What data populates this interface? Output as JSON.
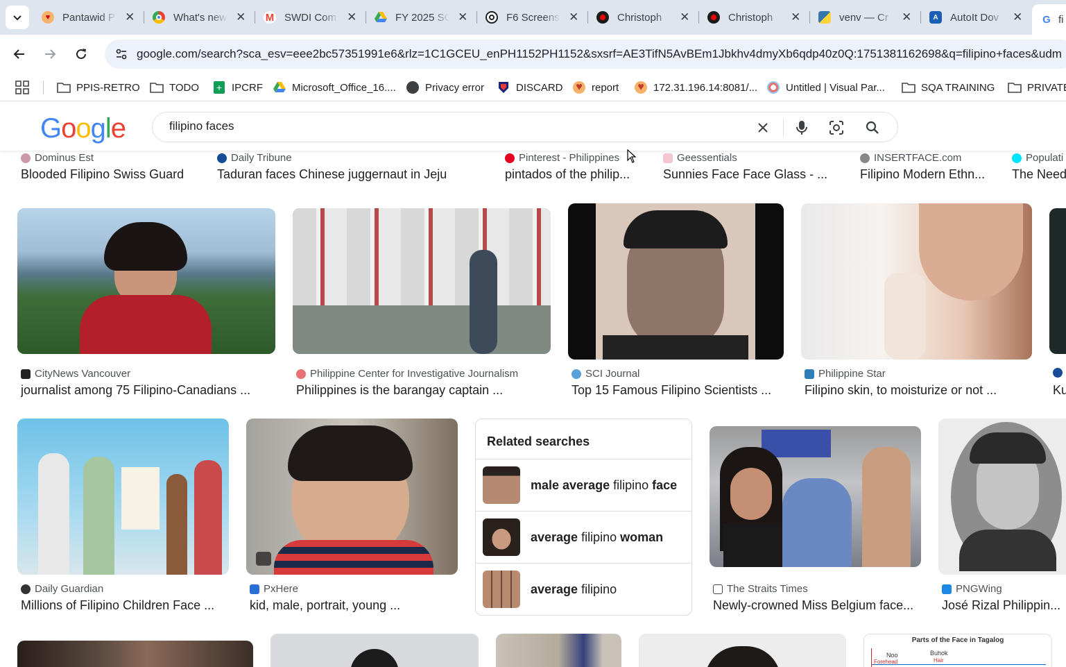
{
  "tabs": [
    {
      "title": "Pantawid P",
      "favicon": "heart-icon",
      "color": "#e8453c"
    },
    {
      "title": "What's new",
      "favicon": "chrome-icon",
      "color": "#4285f4"
    },
    {
      "title": "SWDI Com",
      "favicon": "gmail-icon",
      "color": "#ea4335"
    },
    {
      "title": "FY 2025 SC",
      "favicon": "drive-icon",
      "color": "#fbbc04"
    },
    {
      "title": "F6 Screens",
      "favicon": "openai-icon",
      "color": "#202124"
    },
    {
      "title": "Christoph",
      "favicon": "red-circle-icon",
      "color": "#b00020"
    },
    {
      "title": "Christoph",
      "favicon": "red-circle-icon",
      "color": "#b00020"
    },
    {
      "title": "venv — Cr",
      "favicon": "python-icon",
      "color": "#3776ab"
    },
    {
      "title": "AutoIt Dov",
      "favicon": "autoit-icon",
      "color": "#1a5fb4"
    },
    {
      "title": "fi",
      "favicon": "google-icon",
      "color": "#4285f4"
    }
  ],
  "omnibox": {
    "url": "google.com/search?sca_esv=eee2bc57351991e6&rlz=1C1GCEU_enPH1152PH1152&sxsrf=AE3TifN5AvBEm1Jbkhv4dmyXb6qdp40z0Q:1751381162698&q=filipino+faces&udm"
  },
  "bookmarks": [
    {
      "label": "PPIS-RETRO",
      "icon": "folder-icon"
    },
    {
      "label": "TODO",
      "icon": "folder-icon"
    },
    {
      "label": "IPCRF",
      "icon": "sheets-icon"
    },
    {
      "label": "Microsoft_Office_16....",
      "icon": "drive-icon"
    },
    {
      "label": "Privacy error",
      "icon": "globe-icon"
    },
    {
      "label": "DISCARD",
      "icon": "shield-icon"
    },
    {
      "label": "report",
      "icon": "heart-icon"
    },
    {
      "label": "172.31.196.14:8081/...",
      "icon": "heart-icon"
    },
    {
      "label": "Untitled | Visual Par...",
      "icon": "vp-icon"
    },
    {
      "label": "SQA TRAINING",
      "icon": "folder-icon"
    },
    {
      "label": "PRIVATE",
      "icon": "folder-icon"
    }
  ],
  "search": {
    "logo": "Google",
    "query": "filipino faces"
  },
  "top_row": [
    {
      "source": "Dominus Est",
      "caption": "Blooded Filipino Swiss Guard"
    },
    {
      "source": "Daily Tribune",
      "caption": "Taduran faces Chinese juggernaut in Jeju"
    },
    {
      "source": "Pinterest - Philippines",
      "caption": "pintados of the philip..."
    },
    {
      "source": "Geessentials",
      "caption": "Sunnies Face Face Glass - ..."
    },
    {
      "source": "INSERTFACE.com",
      "caption": "Filipino Modern Ethn..."
    },
    {
      "source": "Populati",
      "caption": "The Need"
    }
  ],
  "row2": [
    {
      "source": "CityNews Vancouver",
      "caption": "journalist among 75 Filipino-Canadians ..."
    },
    {
      "source": "Philippine Center for Investigative Journalism",
      "caption": "Philippines is the barangay captain ..."
    },
    {
      "source": "SCI Journal",
      "caption": "Top 15 Famous Filipino Scientists ..."
    },
    {
      "source": "Philippine Star",
      "caption": "Filipino skin, to moisturize or not ..."
    },
    {
      "source": "",
      "caption": "Ku"
    }
  ],
  "row3": [
    {
      "source": "Daily Guardian",
      "caption": "Millions of Filipino Children Face ..."
    },
    {
      "source": "PxHere",
      "caption": "kid, male, portrait, young ..."
    },
    {
      "source": "The Straits Times",
      "caption": "Newly-crowned Miss Belgium face..."
    },
    {
      "source": "PNGWing",
      "caption": "José Rizal Philippin..."
    }
  ],
  "related": {
    "title": "Related searches",
    "items": [
      {
        "plain1": "",
        "bold1": "male average ",
        "plain2": "filipino ",
        "bold2": "face"
      },
      {
        "plain1": "",
        "bold1": "average ",
        "plain2": "filipino ",
        "bold2": "woman"
      },
      {
        "plain1": "",
        "bold1": "average ",
        "plain2": "filipino",
        "bold2": ""
      }
    ]
  },
  "row4_chart_text": {
    "title": "Parts of the Face in Tagalog",
    "label1": "Noo",
    "label2": "Buhok",
    "label3": "Forehead",
    "label4": "Hair"
  }
}
